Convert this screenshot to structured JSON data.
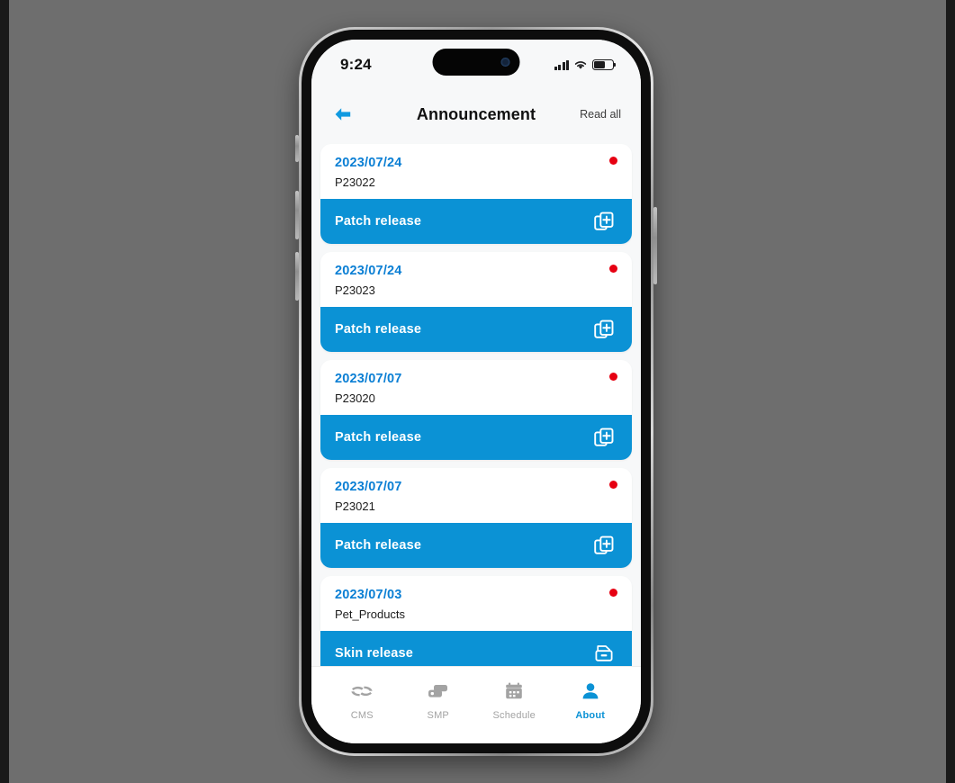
{
  "device": {
    "status_bar": {
      "time": "9:24",
      "signal_icon": "cellular-signal-icon",
      "wifi_icon": "wifi-icon",
      "battery_icon": "battery-icon",
      "camera_icon": "front-camera-icon"
    }
  },
  "nav": {
    "back_icon": "back-arrow-icon",
    "title": "Announcement",
    "read_all_label": "Read all"
  },
  "announcements": [
    {
      "date": "2023/07/24",
      "code": "P23022",
      "action_label": "Patch release",
      "action_icon": "copy-add-icon",
      "unread": true
    },
    {
      "date": "2023/07/24",
      "code": "P23023",
      "action_label": "Patch release",
      "action_icon": "copy-add-icon",
      "unread": true
    },
    {
      "date": "2023/07/07",
      "code": "P23020",
      "action_label": "Patch release",
      "action_icon": "copy-add-icon",
      "unread": true
    },
    {
      "date": "2023/07/07",
      "code": "P23021",
      "action_label": "Patch release",
      "action_icon": "copy-add-icon",
      "unread": true
    },
    {
      "date": "2023/07/03",
      "code": "Pet_Products",
      "action_label": "Skin release",
      "action_icon": "archive-box-icon",
      "unread": true
    }
  ],
  "tabs": [
    {
      "label": "CMS",
      "icon": "cms-icon",
      "active": false
    },
    {
      "label": "SMP",
      "icon": "smp-icon",
      "active": false
    },
    {
      "label": "Schedule",
      "icon": "calendar-icon",
      "active": false
    },
    {
      "label": "About",
      "icon": "person-icon",
      "active": true
    }
  ],
  "colors": {
    "accent_blue": "#0b92d5",
    "date_blue": "#0b7fd4",
    "unread_red": "#e60012",
    "page_background": "#6e6e6e",
    "screen_background": "#f7f8f9",
    "inactive_tab": "#a3a3a3"
  }
}
